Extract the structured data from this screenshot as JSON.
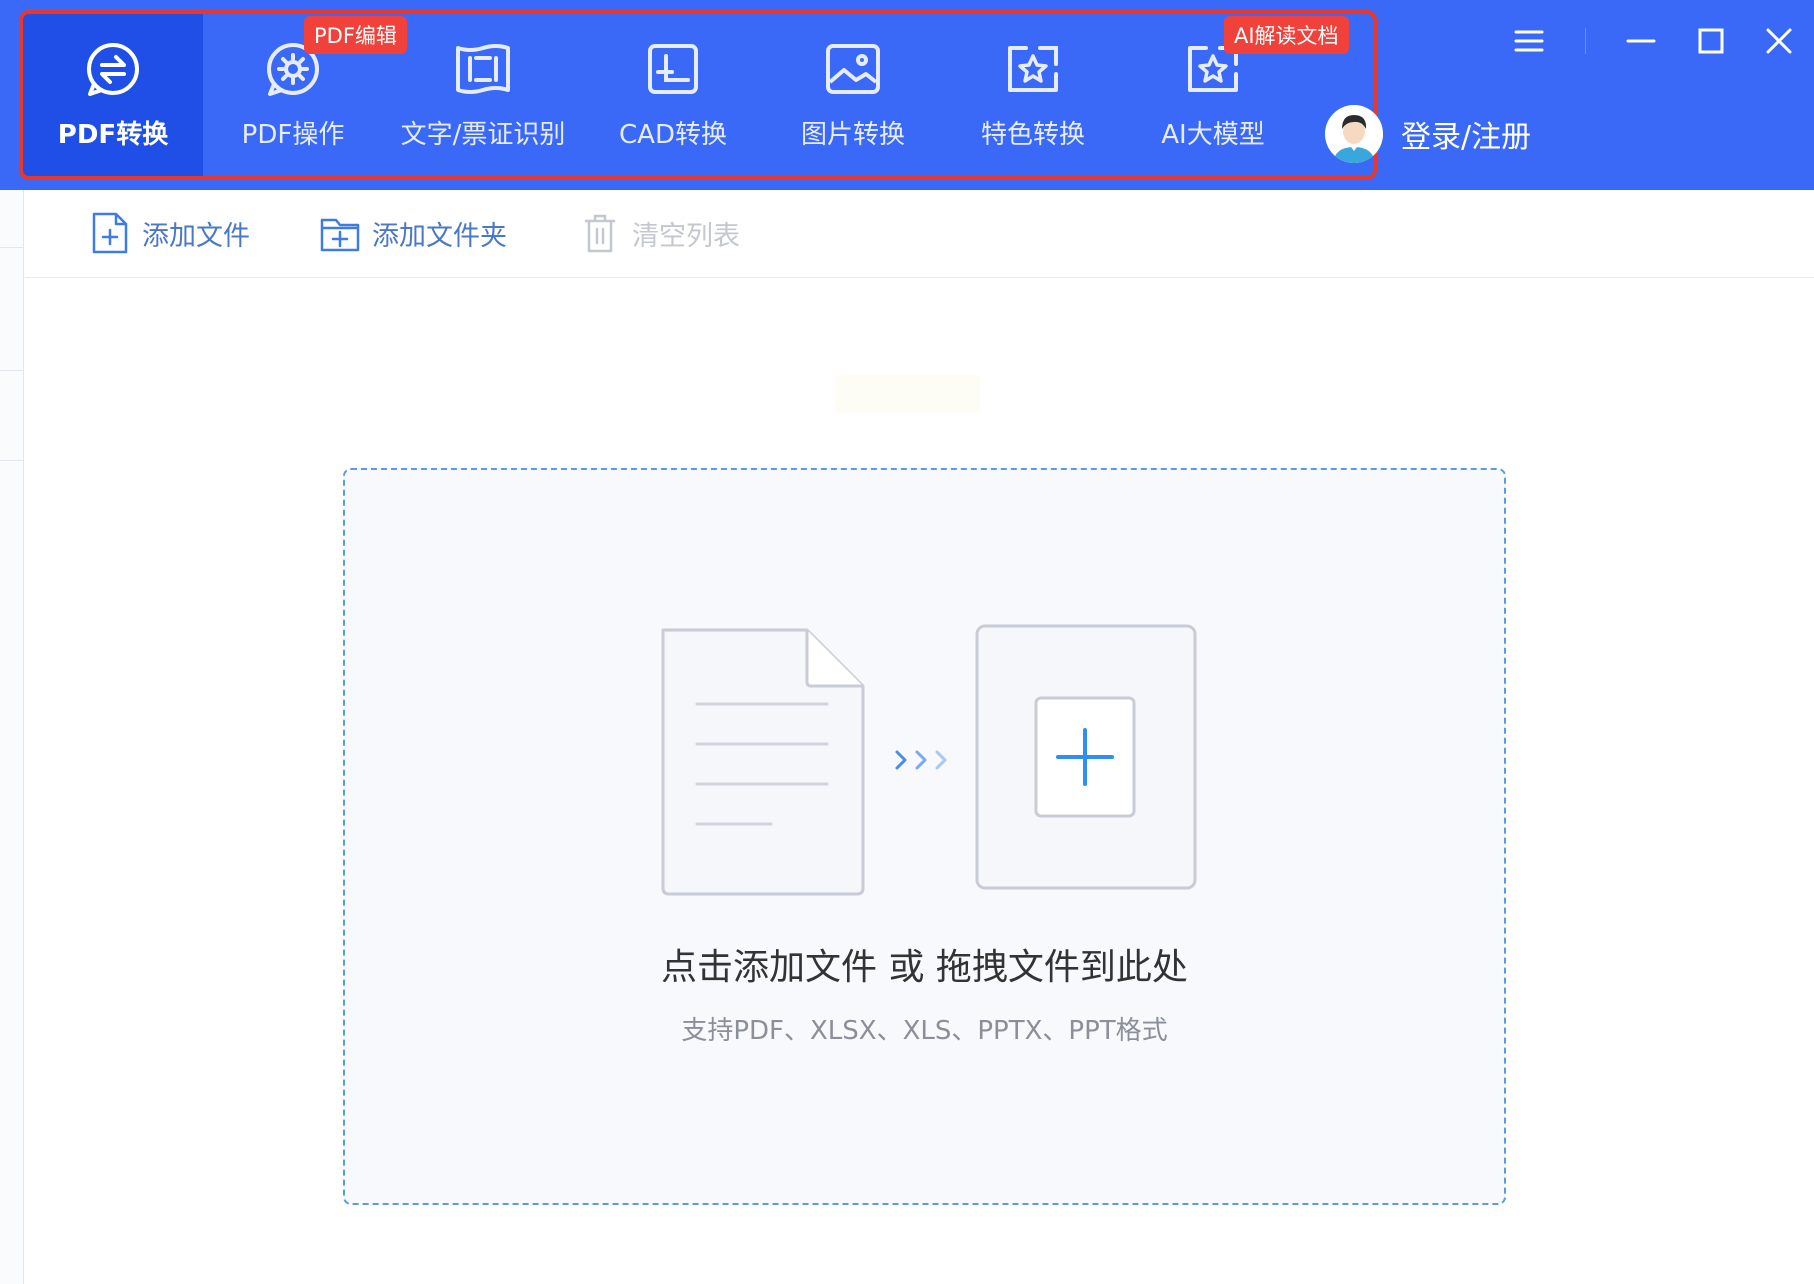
{
  "colors": {
    "topbar": "#3a68f7",
    "topbar_active_tab": "#1f4fe6",
    "badge": "#f0413a",
    "highlight": "#e8382c",
    "dropzone_border": "#5a9be6",
    "accent_plus": "#2d8ff0"
  },
  "nav": {
    "tabs": [
      {
        "label": "PDF转换",
        "icon": "pdf-convert-icon",
        "active": true,
        "badge": ""
      },
      {
        "label": "PDF操作",
        "icon": "pdf-operate-icon",
        "active": false,
        "badge": "PDF编辑"
      },
      {
        "label": "文字/票证识别",
        "icon": "ocr-scan-icon",
        "active": false,
        "badge": ""
      },
      {
        "label": "CAD转换",
        "icon": "cad-convert-icon",
        "active": false,
        "badge": ""
      },
      {
        "label": "图片转换",
        "icon": "image-convert-icon",
        "active": false,
        "badge": ""
      },
      {
        "label": "特色转换",
        "icon": "special-convert-icon",
        "active": false,
        "badge": ""
      },
      {
        "label": "AI大模型",
        "icon": "ai-model-icon",
        "active": false,
        "badge": "AI解读文档"
      }
    ]
  },
  "user": {
    "login_label": "登录/注册",
    "avatar_icon": "user-avatar-icon"
  },
  "window_controls": [
    "menu-icon",
    "minimize-icon",
    "maximize-icon",
    "close-icon"
  ],
  "toolbar": {
    "add_file": "添加文件",
    "add_folder": "添加文件夹",
    "clear_list": "清空列表"
  },
  "dropzone": {
    "title": "点击添加文件 或 拖拽文件到此处",
    "subtitle": "支持PDF、XLSX、XLS、PPTX、PPT格式"
  }
}
